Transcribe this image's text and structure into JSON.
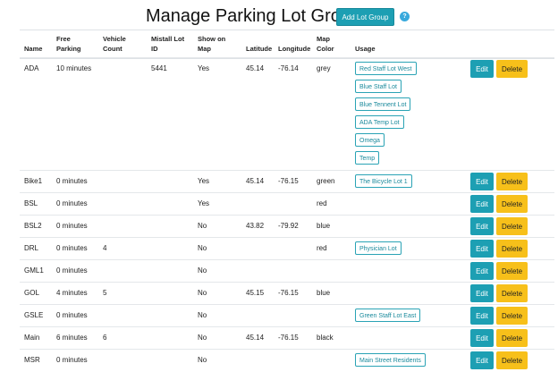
{
  "page": {
    "title": "Manage Parking Lot Groups",
    "add_button_label": "Add Lot Group",
    "help_icon_glyph": "?"
  },
  "columns": {
    "name": "Name",
    "free_parking": "Free Parking",
    "vehicle_count": "Vehicle Count",
    "mistall_lot_id": "Mistall Lot ID",
    "show_on_map": "Show on Map",
    "latitude": "Latitude",
    "longitude": "Longitude",
    "map_color": "Map Color",
    "usage": "Usage"
  },
  "actions": {
    "edit": "Edit",
    "delete": "Delete"
  },
  "colors": {
    "accent": "#1d9fb3",
    "warning": "#f7c01a"
  },
  "rows": [
    {
      "name": "ADA",
      "free_parking": "10 minutes",
      "vehicle_count": "",
      "lot_id": "5441",
      "show_on_map": "Yes",
      "latitude": "45.14",
      "longitude": "-76.14",
      "map_color": "grey",
      "usage": [
        "Red Staff Lot West",
        "Blue Staff Lot",
        "Blue Tennent Lot",
        "ADA Temp Lot",
        "Omega",
        "Temp"
      ]
    },
    {
      "name": "Bike1",
      "free_parking": "0 minutes",
      "vehicle_count": "",
      "lot_id": "",
      "show_on_map": "Yes",
      "latitude": "45.14",
      "longitude": "-76.15",
      "map_color": "green",
      "usage": [
        "The Bicycle Lot 1"
      ]
    },
    {
      "name": "BSL",
      "free_parking": "0 minutes",
      "vehicle_count": "",
      "lot_id": "",
      "show_on_map": "Yes",
      "latitude": "",
      "longitude": "",
      "map_color": "red",
      "usage": []
    },
    {
      "name": "BSL2",
      "free_parking": "0 minutes",
      "vehicle_count": "",
      "lot_id": "",
      "show_on_map": "No",
      "latitude": "43.82",
      "longitude": "-79.92",
      "map_color": "blue",
      "usage": []
    },
    {
      "name": "DRL",
      "free_parking": "0 minutes",
      "vehicle_count": "4",
      "lot_id": "",
      "show_on_map": "No",
      "latitude": "",
      "longitude": "",
      "map_color": "red",
      "usage": [
        "Physician Lot"
      ]
    },
    {
      "name": "GML1",
      "free_parking": "0 minutes",
      "vehicle_count": "",
      "lot_id": "",
      "show_on_map": "No",
      "latitude": "",
      "longitude": "",
      "map_color": "",
      "usage": []
    },
    {
      "name": "GOL",
      "free_parking": "4 minutes",
      "vehicle_count": "5",
      "lot_id": "",
      "show_on_map": "No",
      "latitude": "45.15",
      "longitude": "-76.15",
      "map_color": "blue",
      "usage": []
    },
    {
      "name": "GSLE",
      "free_parking": "0 minutes",
      "vehicle_count": "",
      "lot_id": "",
      "show_on_map": "No",
      "latitude": "",
      "longitude": "",
      "map_color": "",
      "usage": [
        "Green Staff Lot East"
      ]
    },
    {
      "name": "Main",
      "free_parking": "6 minutes",
      "vehicle_count": "6",
      "lot_id": "",
      "show_on_map": "No",
      "latitude": "45.14",
      "longitude": "-76.15",
      "map_color": "black",
      "usage": []
    },
    {
      "name": "MSR",
      "free_parking": "0 minutes",
      "vehicle_count": "",
      "lot_id": "",
      "show_on_map": "No",
      "latitude": "",
      "longitude": "",
      "map_color": "",
      "usage": [
        "Main Street Residents"
      ]
    }
  ]
}
